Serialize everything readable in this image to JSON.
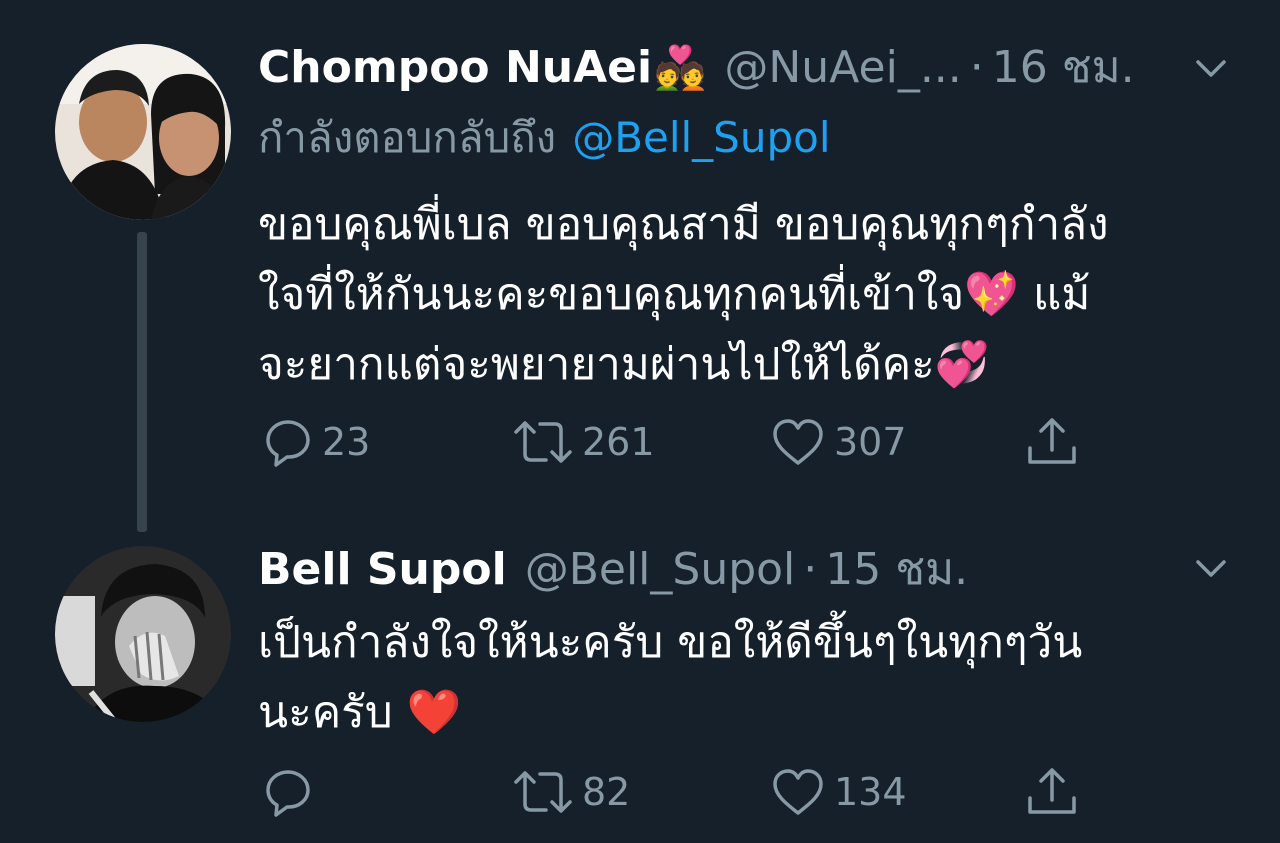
{
  "tweets": [
    {
      "name": "Chompoo NuAei",
      "name_emoji": "💑",
      "handle": "@NuAei_...",
      "separator": "·",
      "time": "16 ชม.",
      "replying_label": "กำลังตอบกลับถึง",
      "replying_to": "@Bell_Supol",
      "lines": [
        "ขอบคุณพี่เบล ขอบคุณสามี ขอบคุณทุกๆกำลัง",
        "ใจที่ให้กันนะคะขอบคุณทุกคนที่เข้าใจ💖 แม้",
        "จะยากแต่จะพยายามผ่านไปให้ได้คะ💞"
      ],
      "reply_count": "23",
      "retweet_count": "261",
      "like_count": "307"
    },
    {
      "name": "Bell Supol",
      "handle": "@Bell_Supol",
      "separator": "·",
      "time": "15 ชม.",
      "lines": [
        "เป็นกำลังใจให้นะครับ ขอให้ดีขึ้นๆในทุกๆวัน",
        "นะครับ ❤️"
      ],
      "reply_count": "",
      "retweet_count": "82",
      "like_count": "134"
    }
  ],
  "icons": {
    "reply": "reply-icon",
    "retweet": "retweet-icon",
    "like": "heart-icon",
    "share": "share-icon",
    "menu": "chevron-down-icon"
  },
  "colors": {
    "background": "#15202b",
    "text": "#ffffff",
    "secondary": "#8899a6",
    "link": "#1da1f2",
    "thread_line": "#38444d"
  }
}
